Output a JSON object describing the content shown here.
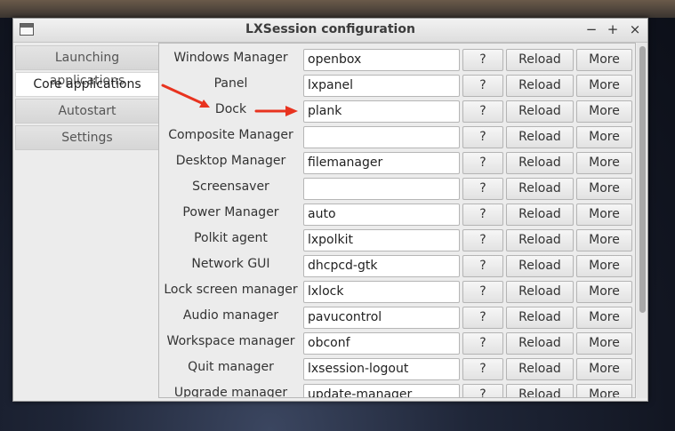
{
  "window": {
    "title": "LXSession configuration",
    "controls": {
      "minimize": "−",
      "maximize": "+",
      "close": "×"
    }
  },
  "sidebar": {
    "items": [
      {
        "label": "Launching applications",
        "active": false
      },
      {
        "label": "Core applications",
        "active": true
      },
      {
        "label": "Autostart",
        "active": false
      },
      {
        "label": "Settings",
        "active": false
      }
    ]
  },
  "rows": [
    {
      "label": "Windows Manager",
      "value": "openbox"
    },
    {
      "label": "Panel",
      "value": "lxpanel"
    },
    {
      "label": "Dock",
      "value": "plank"
    },
    {
      "label": "Composite Manager",
      "value": ""
    },
    {
      "label": "Desktop Manager",
      "value": "filemanager"
    },
    {
      "label": "Screensaver",
      "value": ""
    },
    {
      "label": "Power Manager",
      "value": "auto"
    },
    {
      "label": "Polkit agent",
      "value": "lxpolkit"
    },
    {
      "label": "Network GUI",
      "value": "dhcpcd-gtk"
    },
    {
      "label": "Lock screen manager",
      "value": "lxlock"
    },
    {
      "label": "Audio manager",
      "value": "pavucontrol"
    },
    {
      "label": "Workspace manager",
      "value": "obconf"
    },
    {
      "label": "Quit manager",
      "value": "lxsession-logout"
    },
    {
      "label": "Upgrade manager",
      "value": "update-manager"
    }
  ],
  "buttons": {
    "help": "?",
    "reload": "Reload",
    "more": "More"
  },
  "colors": {
    "annotation_arrow": "#e8331f"
  }
}
